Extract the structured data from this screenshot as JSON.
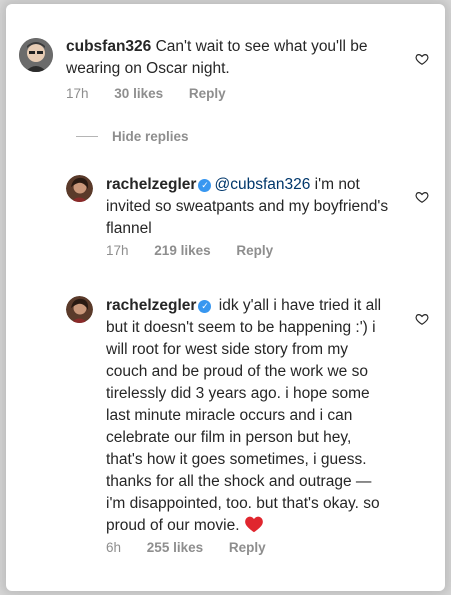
{
  "comments": [
    {
      "username": "cubsfan326",
      "text": "Can't wait to see what you'll be wearing on Oscar night.",
      "time": "17h",
      "likes": "30 likes",
      "reply": "Reply"
    }
  ],
  "hide_replies": "Hide replies",
  "replies": [
    {
      "username": "rachelzegler",
      "mention": "@cubsfan326",
      "text_line1": "i'm",
      "text_rest": "not invited so sweatpants and my boyfriend's flannel",
      "time": "17h",
      "likes": "219 likes",
      "reply": "Reply"
    },
    {
      "username": "rachelzegler",
      "text_line1": "idk y'all i have tried",
      "text_rest": "it all but it doesn't seem to be happening :') i will root for west side story from my couch and be proud of the work we so tirelessly did 3 years ago. i hope some last minute miracle occurs and i can celebrate our film in person but hey, that's how it goes sometimes, i guess. thanks for all the shock and outrage — i'm disappointed, too. but that's okay. so proud of our movie.",
      "time": "6h",
      "likes": "255 likes",
      "reply": "Reply"
    }
  ],
  "colors": {
    "link": "#00376b",
    "meta": "#8e8e8e",
    "verified": "#3897f0",
    "emoji_heart": "#e0262e"
  }
}
